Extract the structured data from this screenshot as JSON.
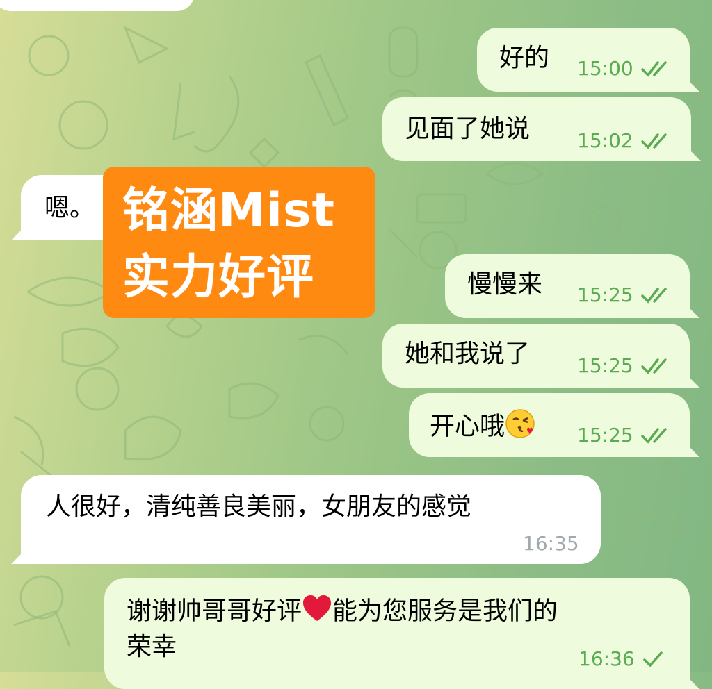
{
  "chat": {
    "messages": [
      {
        "direction": "out",
        "text": "好的",
        "time": "15:00",
        "status": "read"
      },
      {
        "direction": "out",
        "text": "见面了她说",
        "time": "15:02",
        "status": "read"
      },
      {
        "direction": "in",
        "text": "嗯。"
      },
      {
        "direction": "out",
        "text": "慢慢来",
        "time": "15:25",
        "status": "read"
      },
      {
        "direction": "out",
        "text": "她和我说了",
        "time": "15:25",
        "status": "read"
      },
      {
        "direction": "out",
        "text": "开心哦",
        "emoji": "kissing-face-emoji",
        "time": "15:25",
        "status": "read"
      },
      {
        "direction": "in",
        "text": "人很好，清纯善良美丽，女朋友的感觉",
        "time": "16:35"
      },
      {
        "direction": "out",
        "line1_part1": "谢谢帅哥哥好评",
        "emoji": "red-heart-emoji",
        "line1_part2": "能为您服务是我们的",
        "line2": "荣幸",
        "time": "16:36",
        "status": "sent"
      }
    ]
  },
  "overlay_badge": {
    "line1": "铭涵Mist",
    "line2": "实力好评",
    "color": "#ff8a12"
  },
  "colors": {
    "outgoing_bubble": "#eefbdc",
    "incoming_bubble": "#ffffff",
    "outgoing_time": "#5aab51",
    "incoming_time": "#a3a8ad"
  }
}
